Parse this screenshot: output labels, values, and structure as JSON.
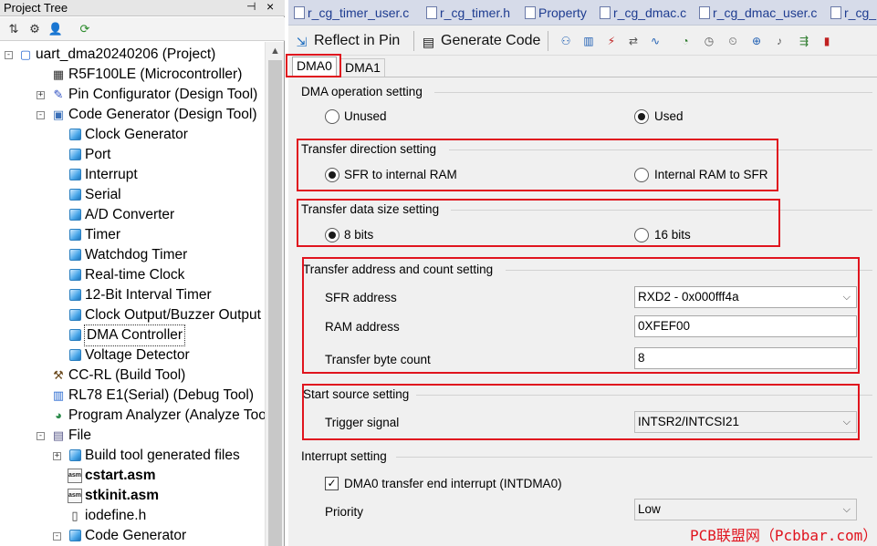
{
  "project_tree": {
    "title": "Project Tree",
    "pin_glyph": "ㅋ",
    "close_glyph": "×",
    "toolbar": [
      "sort-icon",
      "gear-icon",
      "user-icon",
      "refresh-icon"
    ],
    "nodes": [
      {
        "label": "uart_dma20240206 (Project)",
        "icon": "folder-icon",
        "bold": false
      },
      {
        "label": "R5F100LE (Microcontroller)",
        "icon": "chip-icon"
      },
      {
        "label": "Pin Configurator (Design Tool)",
        "icon": "pin-icon"
      },
      {
        "label": "Code Generator (Design Tool)",
        "icon": "codegen-icon"
      },
      {
        "label": "Clock Generator",
        "icon": "cube-icon"
      },
      {
        "label": "Port",
        "icon": "cube-icon"
      },
      {
        "label": "Interrupt",
        "icon": "cube-icon"
      },
      {
        "label": "Serial",
        "icon": "cube-icon"
      },
      {
        "label": "A/D Converter",
        "icon": "cube-icon"
      },
      {
        "label": "Timer",
        "icon": "cube-icon"
      },
      {
        "label": "Watchdog Timer",
        "icon": "cube-icon"
      },
      {
        "label": "Real-time Clock",
        "icon": "cube-icon"
      },
      {
        "label": "12-Bit Interval Timer",
        "icon": "cube-icon"
      },
      {
        "label": "Clock Output/Buzzer Output",
        "icon": "cube-icon"
      },
      {
        "label": "DMA Controller",
        "icon": "cube-icon",
        "selected": true
      },
      {
        "label": "Voltage Detector",
        "icon": "cube-icon"
      },
      {
        "label": "CC-RL (Build Tool)",
        "icon": "hammer-icon"
      },
      {
        "label": "RL78 E1(Serial) (Debug Tool)",
        "icon": "debug-icon"
      },
      {
        "label": "Program Analyzer (Analyze Tool)",
        "icon": "analyzer-icon"
      },
      {
        "label": "File",
        "icon": "file-folder-icon"
      },
      {
        "label": "Build tool generated files",
        "icon": "cube-icon"
      },
      {
        "label": "cstart.asm",
        "icon": "asm-file-icon",
        "bold": true
      },
      {
        "label": "stkinit.asm",
        "icon": "asm-file-icon",
        "bold": true
      },
      {
        "label": "iodefine.h",
        "icon": "header-file-icon"
      },
      {
        "label": "Code Generator",
        "icon": "cube-icon"
      }
    ],
    "asm_tag": "asm"
  },
  "doc_tabs": [
    "r_cg_timer_user.c",
    "r_cg_timer.h",
    "Property",
    "r_cg_dmac.c",
    "r_cg_dmac_user.c",
    "r_cg_"
  ],
  "toolbar": {
    "reflect": "Reflect in Pin",
    "generate": "Generate Code"
  },
  "sub_tabs": [
    "DMA0",
    "DMA1"
  ],
  "dma": {
    "operation": {
      "title": "DMA operation setting",
      "opt1": "Unused",
      "opt2": "Used",
      "selected": "Used"
    },
    "direction": {
      "title": "Transfer direction setting",
      "opt1": "SFR to internal RAM",
      "opt2": "Internal RAM to SFR",
      "selected": "SFR to internal RAM"
    },
    "datasize": {
      "title": "Transfer data size setting",
      "opt1": "8 bits",
      "opt2": "16 bits",
      "selected": "8 bits"
    },
    "address": {
      "title": "Transfer address and count setting",
      "sfr_label": "SFR address",
      "sfr_value": "RXD2 - 0x000fff4a",
      "ram_label": "RAM address",
      "ram_value": "0XFEF00",
      "count_label": "Transfer byte count",
      "count_value": "8"
    },
    "start": {
      "title": "Start source setting",
      "trigger_label": "Trigger signal",
      "trigger_value": "INTSR2/INTCSI21"
    },
    "interrupt": {
      "title": "Interrupt setting",
      "check_label": "DMA0 transfer end interrupt (INTDMA0)",
      "checked": true,
      "priority_label": "Priority",
      "priority_value": "Low"
    }
  },
  "watermark": "PCB联盟网（Pcbbar.com）",
  "colors": {
    "highlight_red": "#e0141e",
    "tab_text": "#1e3c90"
  }
}
